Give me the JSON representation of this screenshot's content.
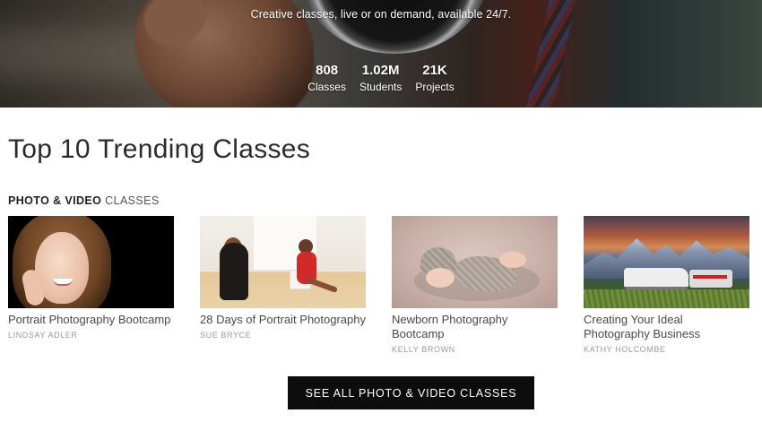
{
  "hero": {
    "tagline": "Creative classes, live or on demand, available 24/7.",
    "stats": [
      {
        "value": "808",
        "label": "Classes"
      },
      {
        "value": "1.02M",
        "label": "Students"
      },
      {
        "value": "21K",
        "label": "Projects"
      }
    ]
  },
  "main": {
    "section_title": "Top 10 Trending Classes",
    "category": {
      "name": "PHOTO & VIDEO",
      "suffix": " CLASSES"
    },
    "cards": [
      {
        "title": "Portrait Photography Bootcamp",
        "author": "LINDSAY ADLER"
      },
      {
        "title": "28 Days of Portrait Photography",
        "author": "SUE BRYCE"
      },
      {
        "title": "Newborn Photography Bootcamp",
        "author": "KELLY BROWN"
      },
      {
        "title": "Creating Your Ideal Photography Business",
        "author": "KATHY HOLCOMBE"
      }
    ],
    "cta_label": "SEE ALL PHOTO & VIDEO CLASSES"
  }
}
